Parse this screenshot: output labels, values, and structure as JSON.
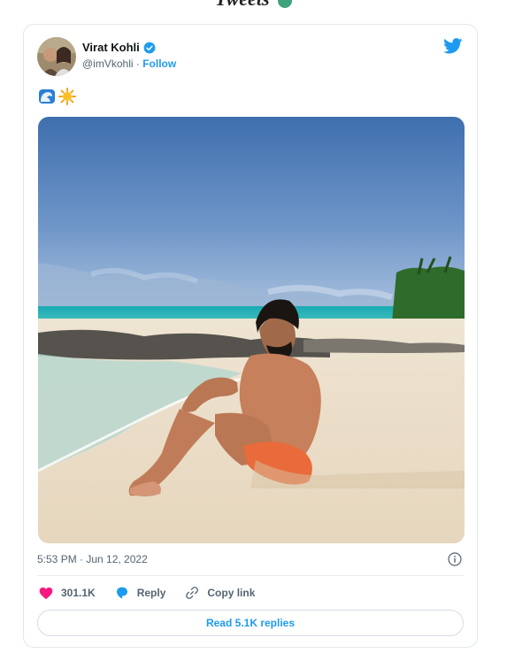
{
  "header": {
    "title": "Tweets"
  },
  "tweet": {
    "author_name": "Virat Kohli",
    "handle": "@imVkohli",
    "separator": "·",
    "follow_label": "Follow",
    "timestamp": "5:53 PM · Jun 12, 2022",
    "likes": "301.1K",
    "reply_label": "Reply",
    "copy_link_label": "Copy link",
    "read_replies_label": "Read 5.1K replies"
  },
  "icons": [
    "verified-badge-icon",
    "twitter-bird-icon",
    "wave-emoji-icon",
    "sun-emoji-icon",
    "info-icon",
    "heart-icon",
    "reply-bubble-icon",
    "link-icon"
  ],
  "colors": {
    "accent": "#1d9bf0",
    "like": "#f91880",
    "text_secondary": "#536471"
  }
}
